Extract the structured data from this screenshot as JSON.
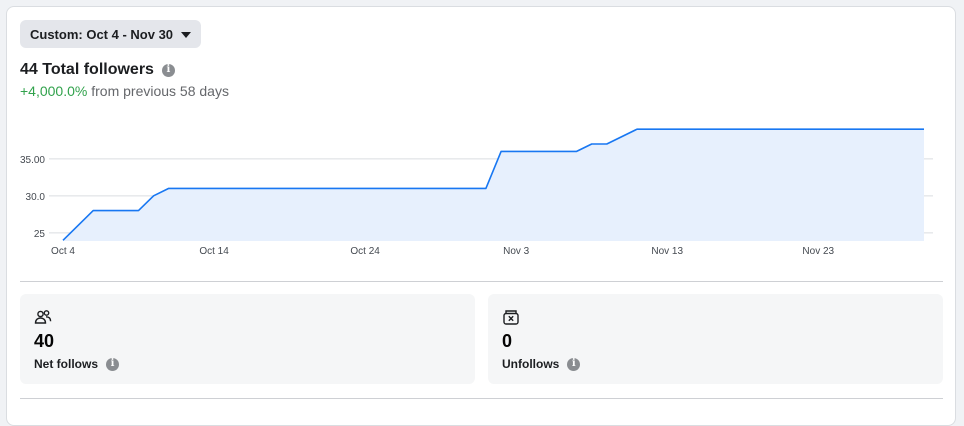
{
  "filter": {
    "label": "Custom: Oct 4 - Nov 30"
  },
  "summary": {
    "title": "44 Total followers",
    "change": "+4,000.0%",
    "change_suffix": " from previous 58 days"
  },
  "chart_data": {
    "type": "area",
    "x_tick_labels": [
      "Oct 4",
      "Oct 14",
      "Oct 24",
      "Nov 3",
      "Nov 13",
      "Nov 23"
    ],
    "y_tick_labels": [
      "25",
      "30.0",
      "35.00"
    ],
    "y_ticks": [
      25,
      30,
      35
    ],
    "ylim": [
      23.9,
      42
    ],
    "x": [
      "2023-10-04",
      "2023-10-06",
      "2023-10-09",
      "2023-10-10",
      "2023-10-11",
      "2023-11-01",
      "2023-11-02",
      "2023-11-07",
      "2023-11-08",
      "2023-11-09",
      "2023-11-11",
      "2023-11-30"
    ],
    "y": [
      24,
      28,
      28,
      30,
      31,
      31,
      36,
      36,
      37,
      37,
      39,
      39
    ],
    "color": "#1877f2",
    "fill": "#e7f0fd"
  },
  "stats": [
    {
      "icon": "people-icon",
      "value": "40",
      "label": "Net follows"
    },
    {
      "icon": "unfollow-icon",
      "value": "0",
      "label": "Unfollows"
    }
  ]
}
